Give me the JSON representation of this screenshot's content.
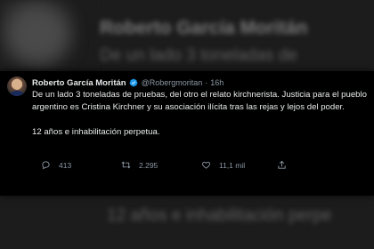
{
  "background": {
    "blurred_name": "Roberto García Moritán",
    "blurred_line": "De un lado 3 toneladas de",
    "blurred_bottom": "12 años e inhabilitación perpe"
  },
  "tweet": {
    "author_name": "Roberto García Moritán",
    "handle": "@Robergmoritan",
    "separator": "·",
    "time": "16h",
    "paragraph1": "De un lado 3 toneladas de pruebas, del otro el relato kirchnerista. Justicia para el pueblo argentino es Cristina Kirchner y su asociación ilícita tras las rejas y lejos del poder.",
    "paragraph2": "12 años e inhabilitación perpetua.",
    "replies": "413",
    "retweets": "2.295",
    "likes": "11,1 mil"
  },
  "colors": {
    "card_bg": "#000000",
    "text": "#e7e9ea",
    "muted": "#8b98a5",
    "verified": "#1d9bf0"
  },
  "icons": [
    "reply-icon",
    "retweet-icon",
    "like-icon",
    "share-icon",
    "verified-icon"
  ]
}
